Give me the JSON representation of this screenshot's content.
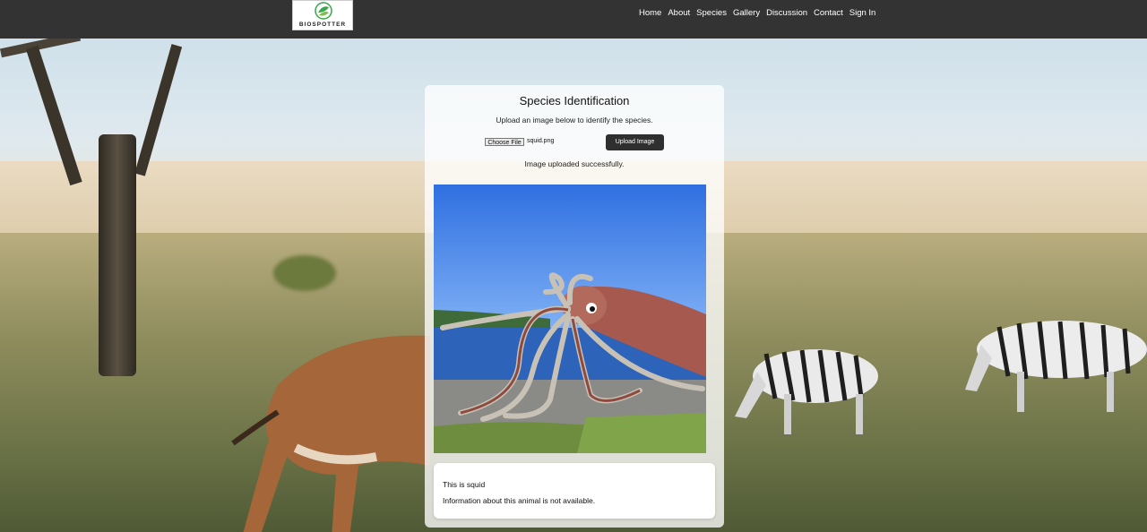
{
  "header": {
    "logo_text": "BIOSPOTTER",
    "nav": [
      "Home",
      "About",
      "Species",
      "Gallery",
      "Discussion",
      "Contact",
      "Sign In"
    ]
  },
  "card": {
    "title": "Species Identification",
    "subtitle": "Upload an image below to identify the species.",
    "choose_file_label": "Choose File",
    "file_name": "squid.png",
    "upload_label": "Upload Image",
    "status": "Image uploaded successfully.",
    "result": {
      "line1": "This is squid",
      "line2": "Information about this animal is not available."
    }
  },
  "icons": {
    "logo": "leaf-globe-icon"
  },
  "colors": {
    "navbar": "#333333",
    "upload_button": "#2f2f2f",
    "logo_green": "#3aa54a"
  }
}
